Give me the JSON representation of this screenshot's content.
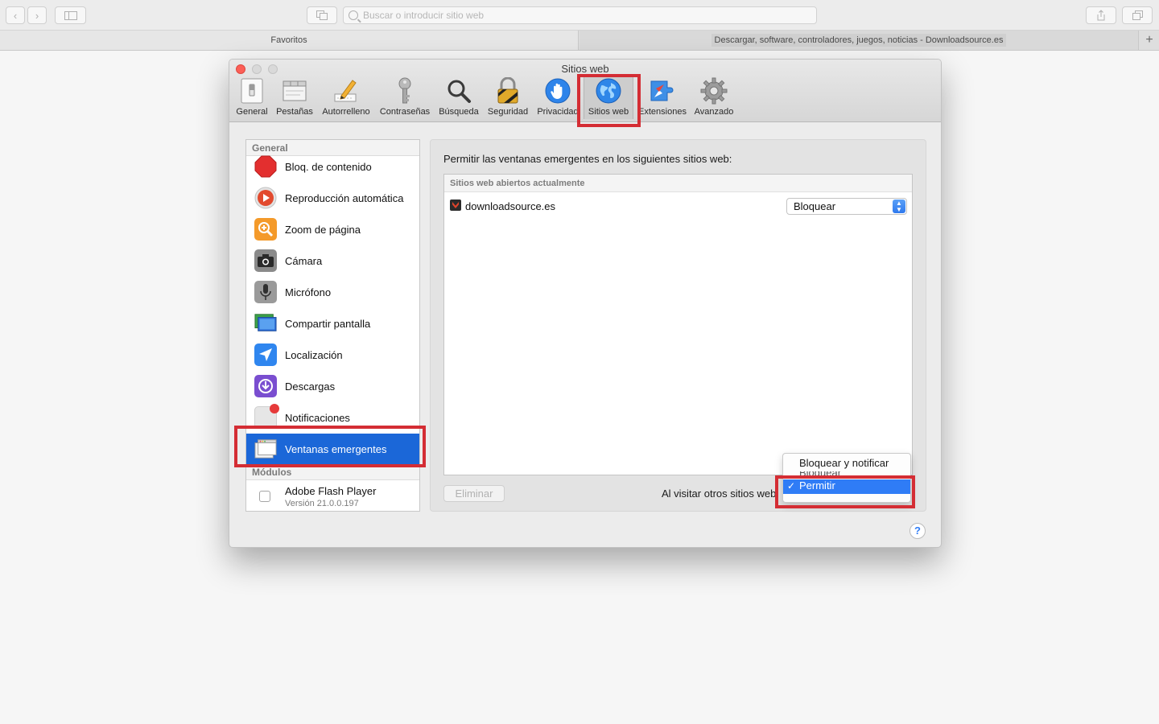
{
  "browser": {
    "address_placeholder": "Buscar o introducir sitio web",
    "tabs": [
      {
        "label": "Favoritos"
      },
      {
        "label": "Descargar, software, controladores, juegos, noticias - Downloadsource.es"
      }
    ],
    "new_tab_label": "+"
  },
  "prefs": {
    "title": "Sitios web",
    "toolbar": [
      {
        "label": "General",
        "icon": "switch-icon"
      },
      {
        "label": "Pestañas",
        "icon": "tabs-icon"
      },
      {
        "label": "Autorrelleno",
        "icon": "pencil-icon"
      },
      {
        "label": "Contraseñas",
        "icon": "key-icon"
      },
      {
        "label": "Búsqueda",
        "icon": "magnifier-icon"
      },
      {
        "label": "Seguridad",
        "icon": "padlock-icon"
      },
      {
        "label": "Privacidad",
        "icon": "hand-icon"
      },
      {
        "label": "Sitios web",
        "icon": "globe-icon",
        "selected": true
      },
      {
        "label": "Extensiones",
        "icon": "compass-puzzle-icon"
      },
      {
        "label": "Avanzado",
        "icon": "gear-icon"
      }
    ],
    "sidebar": {
      "general_header": "General",
      "items": [
        {
          "label": "Bloq. de contenido",
          "icon": "stop-sign-icon"
        },
        {
          "label": "Reproducción automática",
          "icon": "play-icon"
        },
        {
          "label": "Zoom de página",
          "icon": "zoom-icon"
        },
        {
          "label": "Cámara",
          "icon": "camera-icon"
        },
        {
          "label": "Micrófono",
          "icon": "microphone-icon"
        },
        {
          "label": "Compartir pantalla",
          "icon": "screen-share-icon"
        },
        {
          "label": "Localización",
          "icon": "location-arrow-icon"
        },
        {
          "label": "Descargas",
          "icon": "download-icon"
        },
        {
          "label": "Notificaciones",
          "icon": "notification-icon"
        },
        {
          "label": "Ventanas emergentes",
          "icon": "popup-window-icon",
          "selected": true
        }
      ],
      "modules_header": "Módulos",
      "plugin": {
        "name": "Adobe Flash Player",
        "version": "Versión 21.0.0.197"
      }
    },
    "content": {
      "description": "Permitir las ventanas emergentes en los siguientes sitios web:",
      "list_header": "Sitios web abiertos actualmente",
      "sites": [
        {
          "name": "downloadsource.es",
          "setting": "Bloquear"
        }
      ],
      "delete_button": "Eliminar",
      "other_sites_label": "Al visitar otros sitios web:",
      "options": [
        "Bloquear y notificar",
        "Bloquear",
        "Permitir"
      ],
      "selected_option": "Permitir"
    },
    "help": "?"
  },
  "colors": {
    "highlight_box": "#d42d34",
    "selection_blue": "#1b67d8",
    "menu_highlight": "#2f7cf6"
  }
}
